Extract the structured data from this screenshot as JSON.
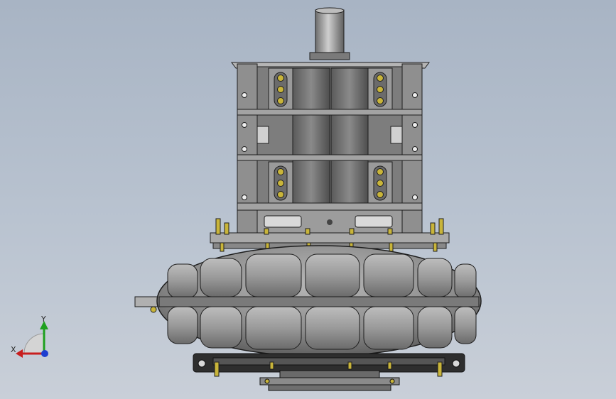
{
  "viewport": {
    "background_top": "#a8b4c4",
    "background_bottom": "#c9cfd8"
  },
  "model": {
    "body_color": "#8e8e8e",
    "shadow_color": "#6a6a6a",
    "highlight_color": "#c8c8c8",
    "bolt_color": "#c9b53a",
    "edge_color": "#1e1e1e",
    "base_color": "#2e2e2e"
  },
  "triad": {
    "x_label": "X",
    "y_label": "Y",
    "x_color": "#c81e1e",
    "y_color": "#1ea01e",
    "z_color": "#1e3ed0"
  }
}
